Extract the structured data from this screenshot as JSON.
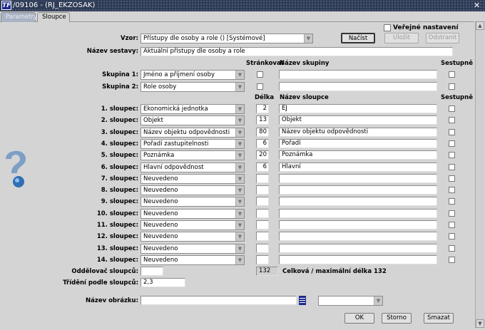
{
  "window": {
    "title": "/09106 - (RJ_EKZOSAK)",
    "app_icon": "TF",
    "close": "✕"
  },
  "tabs": [
    "Parametry",
    "Sloupce"
  ],
  "public": {
    "label": "Veřejné nastavení",
    "checked": false
  },
  "vzor": {
    "label": "Vzor:",
    "value": "Přístupy dle osoby a role   ()   [Systémové]"
  },
  "buttons": {
    "load": "Načíst",
    "save": "Uložit",
    "remove": "Odstranit",
    "ok": "OK",
    "cancel": "Storno",
    "delete": "Smazat"
  },
  "report_name": {
    "label": "Název sestavy:",
    "value": "Aktuální přístupy dle osoby a role"
  },
  "group_headers": {
    "paging": "Stránkovat",
    "group_name": "Název skupiny",
    "desc": "Sestupně"
  },
  "groups": [
    {
      "label": "Skupina 1:",
      "value": "Jméno a příjmení osoby"
    },
    {
      "label": "Skupina 2:",
      "value": "Role osoby"
    }
  ],
  "col_headers": {
    "length": "Délka",
    "col_name": "Název sloupce",
    "desc": "Sestupně"
  },
  "columns": [
    {
      "label": "1. sloupec:",
      "value": "Ekonomická jednotka",
      "length": "2",
      "name": "EJ"
    },
    {
      "label": "2. sloupec:",
      "value": "Objekt",
      "length": "13",
      "name": "Objekt"
    },
    {
      "label": "3. sloupec:",
      "value": "Název objektu odpovědnosti",
      "length": "80",
      "name": "Název objektu odpovědnosti"
    },
    {
      "label": "4. sloupec:",
      "value": "Pořadí zastupitelnosti",
      "length": "6",
      "name": "Pořadí"
    },
    {
      "label": "5. sloupec:",
      "value": "Poznámka",
      "length": "20",
      "name": "Poznámka"
    },
    {
      "label": "6. sloupec:",
      "value": "Hlavní odpovědnost",
      "length": "6",
      "name": "Hlavní"
    },
    {
      "label": "7. sloupec:",
      "value": "Neuvedeno",
      "length": "",
      "name": ""
    },
    {
      "label": "8. sloupec:",
      "value": "Neuvedeno",
      "length": "",
      "name": ""
    },
    {
      "label": "9. sloupec:",
      "value": "Neuvedeno",
      "length": "",
      "name": ""
    },
    {
      "label": "10. sloupec:",
      "value": "Neuvedeno",
      "length": "",
      "name": ""
    },
    {
      "label": "11. sloupec:",
      "value": "Neuvedeno",
      "length": "",
      "name": ""
    },
    {
      "label": "12. sloupec:",
      "value": "Neuvedeno",
      "length": "",
      "name": ""
    },
    {
      "label": "13. sloupec:",
      "value": "Neuvedeno",
      "length": "",
      "name": ""
    },
    {
      "label": "14. sloupec:",
      "value": "Neuvedeno",
      "length": "",
      "name": ""
    }
  ],
  "separator": {
    "label": "Oddělovač sloupců:",
    "value": ""
  },
  "total": {
    "value": "132",
    "label": "Celková / maximální délka 132"
  },
  "sorting": {
    "label": "Třídění podle sloupců:",
    "value": "2,3"
  },
  "image": {
    "label": "Název obrázku:",
    "value": "",
    "select": ""
  }
}
